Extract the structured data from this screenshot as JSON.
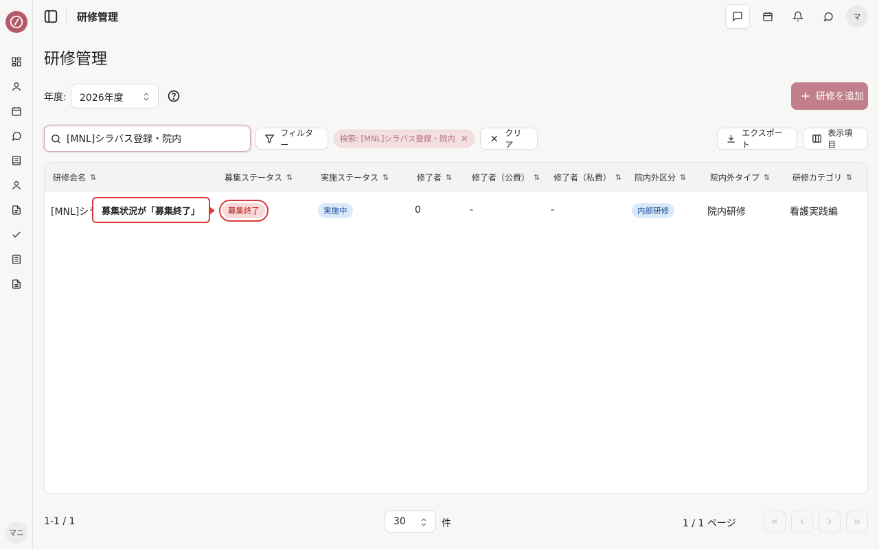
{
  "app": {
    "header_title": "研修管理",
    "user_initials": "マ",
    "sidebar_user": "マニ"
  },
  "page": {
    "title": "研修管理",
    "year_label": "年度:",
    "year_value": "2026年度",
    "add_button": "研修を追加"
  },
  "toolbar": {
    "search_value": "[MNL]シラバス登録・院内",
    "filter_label": "フィルター",
    "search_tag": "検索: [MNL]シラバス登録・院内",
    "clear_label": "クリア",
    "export_label": "エクスポート",
    "columns_label": "表示項目"
  },
  "table": {
    "columns": [
      "研修会名",
      "募集ステータス",
      "実施ステータス",
      "修了者",
      "修了者（公費）",
      "修了者（私費）",
      "院内外区分",
      "院内外タイプ",
      "研修カテゴリ"
    ],
    "rows": [
      {
        "name": "[MNL]シラバス登録・院内",
        "recruit_status": "募集終了",
        "impl_status": "実施中",
        "completed": "0",
        "completed_public": "-",
        "completed_private": "-",
        "inout_class": "内部研修",
        "inout_type": "院内研修",
        "category": "看護実践編"
      }
    ],
    "callout": "募集状況が「募集終了」"
  },
  "footer": {
    "range": "1-1 / 1",
    "page_size": "30",
    "unit": "件",
    "page_info": "1 / 1 ページ"
  },
  "colors": {
    "accent": "#c07f8a",
    "highlight": "#d93a3a",
    "badge_blue_bg": "#dbeaf9"
  }
}
